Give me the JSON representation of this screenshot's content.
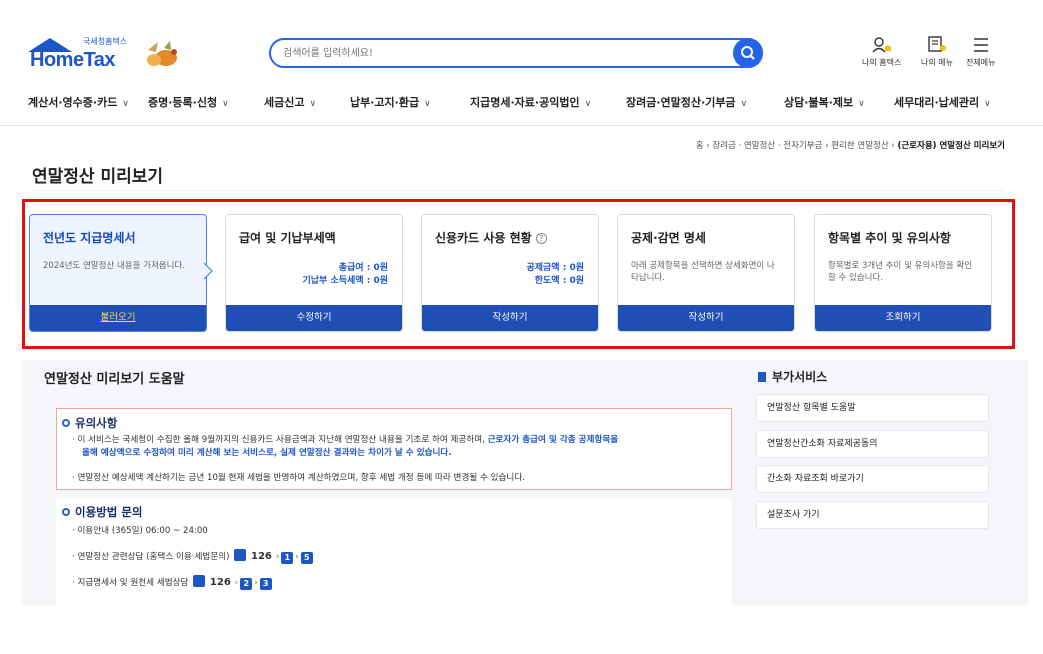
{
  "header": {
    "logo_text": "HomeTax",
    "logo_sub": "국세청홈택스",
    "search_placeholder": "검색어를 입력하세요!",
    "util": [
      {
        "label": "나의 홈택스",
        "icon": "user-bell-icon"
      },
      {
        "label": "나의 메뉴",
        "icon": "menu-person-icon"
      },
      {
        "label": "전체메뉴",
        "icon": "hamburger-icon"
      }
    ]
  },
  "nav": [
    "계산서·영수증·카드",
    "증명·등록·신청",
    "세금신고",
    "납부·고지·환급",
    "지급명세·자료·공익법인",
    "장려금·연말정산·기부금",
    "상담·불복·제보",
    "세무대리·납세관리"
  ],
  "breadcrumb": {
    "path": "홈 › 장려금 · 연말정산 · 전자기부금 › 편리한 연말정산 ›",
    "current": "(근로자용) 연말정산 미리보기"
  },
  "page_title": "연말정산 미리보기",
  "steps": [
    {
      "title": "전년도 지급명세서",
      "desc": "2024년도 연말정산 내용을 가져옵니다.",
      "button": "불러오기"
    },
    {
      "title": "급여 및 기납부세액",
      "vals": [
        "총급여 : 0원",
        "기납부 소득세액 : 0원"
      ],
      "button": "수정하기"
    },
    {
      "title": "신용카드 사용 현황",
      "help": "?",
      "vals": [
        "공제금액 : 0원",
        "한도액 : 0원"
      ],
      "button": "작성하기"
    },
    {
      "title": "공제·감면 명세",
      "desc": "아래 공제항목을 선택하면 상세화면이 나타납니다.",
      "button": "작성하기"
    },
    {
      "title": "항목별 추이 및 유의사항",
      "desc": "항목별로 3개년 추이 및 유의사항을 확인할 수 있습니다.",
      "button": "조회하기"
    }
  ],
  "help": {
    "title": "연말정산 미리보기 도움말",
    "caution_head": "유의사항",
    "caution_1a": "· 이 서비스는 국세청이 수집한 올해 9월까지의 신용카드 사용금액과 지난해 연말정산 내용을 기초로 하여 제공하며, ",
    "caution_1b": "근로자가 총급여 및 각종 공제항목을",
    "caution_1c": "올해 예상액으로 수정하여 미리 계산해 보는 서비스로, 실제 연말정산 결과와는 차이가 날 수 있습니다.",
    "caution_2": "· 연말정산 예상세액 계산하기는 금년 10월 현재 세법을 반영하여 계산하였으며, 향후 세법 개정 등에 따라 변경될 수 있습니다.",
    "inquiry_head": "이용방법 문의",
    "inquiry_hours": "· 이용안내 (365일) 06:00 ~ 24:00",
    "inquiry_1": "· 연말정산 관련상담 (홈택스 이용·세법문의)",
    "inquiry_1_digits": [
      "1",
      "5"
    ],
    "inquiry_2": "· 지급명세서 및 원천세 세법상담",
    "inquiry_2_digits": [
      "2",
      "3"
    ],
    "tel": "126"
  },
  "side": {
    "title": "부가서비스",
    "items": [
      "연말정산 항목별 도움말",
      "연말정산간소화 자료제공동의",
      "간소화 자료조회 바로가기",
      "설문조사 가기"
    ]
  }
}
